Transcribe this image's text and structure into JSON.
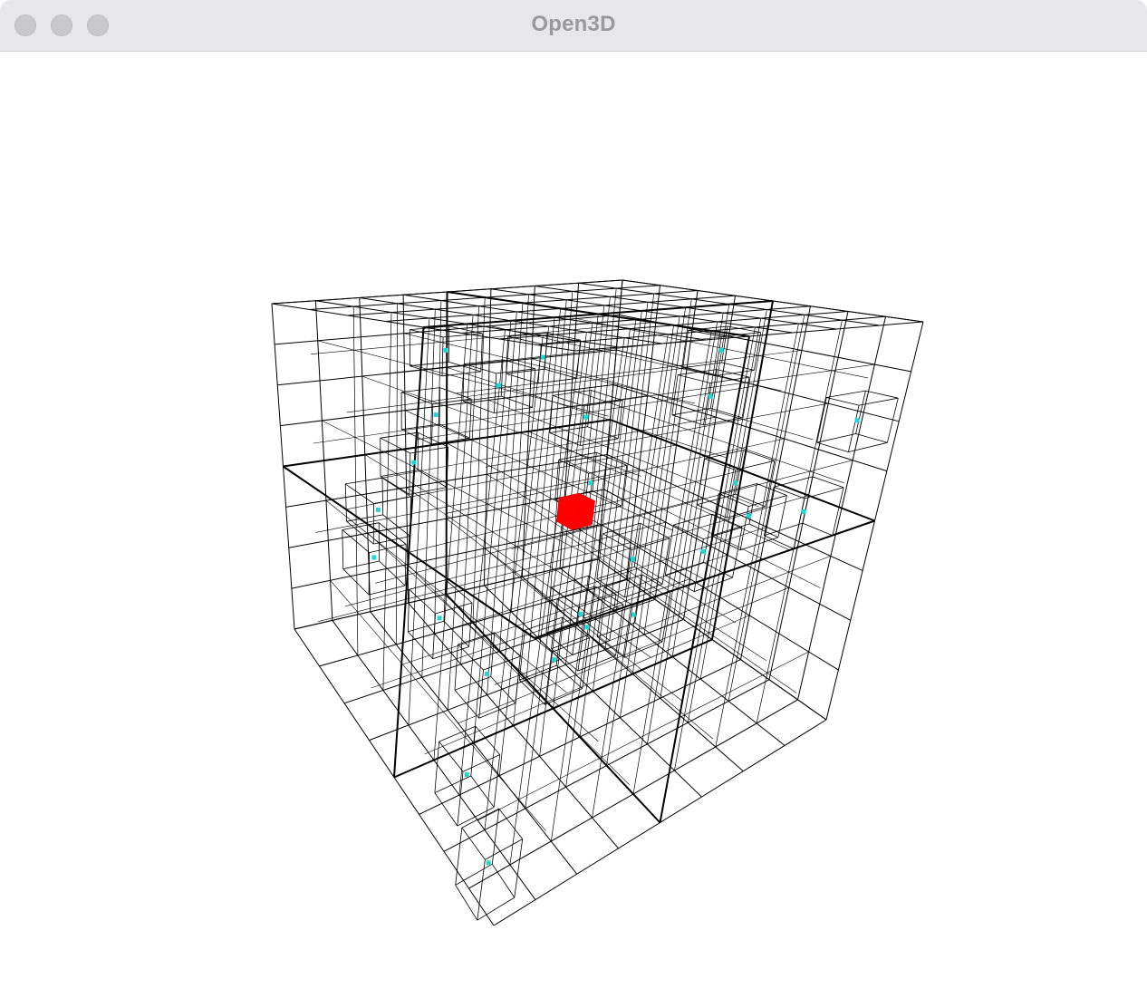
{
  "window": {
    "title": "Open3D"
  },
  "controls": {
    "close_icon": "close-icon",
    "minimize_icon": "minimize-icon",
    "zoom_icon": "zoom-icon"
  },
  "scene": {
    "kind": "octree-wireframe",
    "grid_divisions": 8,
    "line_color": "#000000",
    "background": "#ffffff",
    "query_cube_color": "#ff0000",
    "point_color": "#1fd6d6"
  }
}
